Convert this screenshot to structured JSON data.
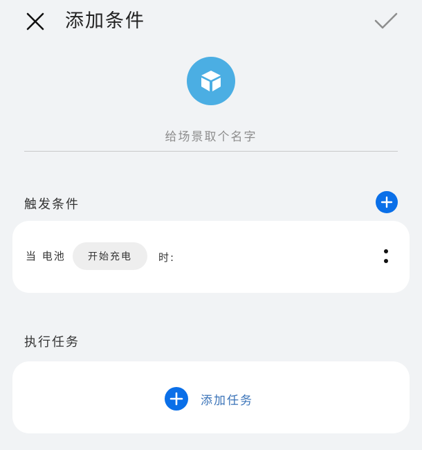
{
  "header": {
    "title": "添加条件",
    "close_icon": "close-icon",
    "confirm_icon": "checkmark-icon"
  },
  "scene": {
    "icon": "cube-icon",
    "icon_color": "#4baee3",
    "name_placeholder": "给场景取个名字",
    "name_value": ""
  },
  "trigger": {
    "section_title": "触发条件",
    "add_icon": "plus-icon",
    "condition": {
      "prefix": "当 电池",
      "state_chip": "开始充电",
      "suffix": "时:",
      "more_icon": "more-vertical-icon"
    }
  },
  "tasks": {
    "section_title": "执行任务",
    "add_task_label": "添加任务",
    "add_icon": "plus-icon"
  },
  "colors": {
    "accent": "#0a6fe8",
    "background": "#f1f3f5",
    "card": "#ffffff",
    "link_text": "#3a73b8"
  }
}
